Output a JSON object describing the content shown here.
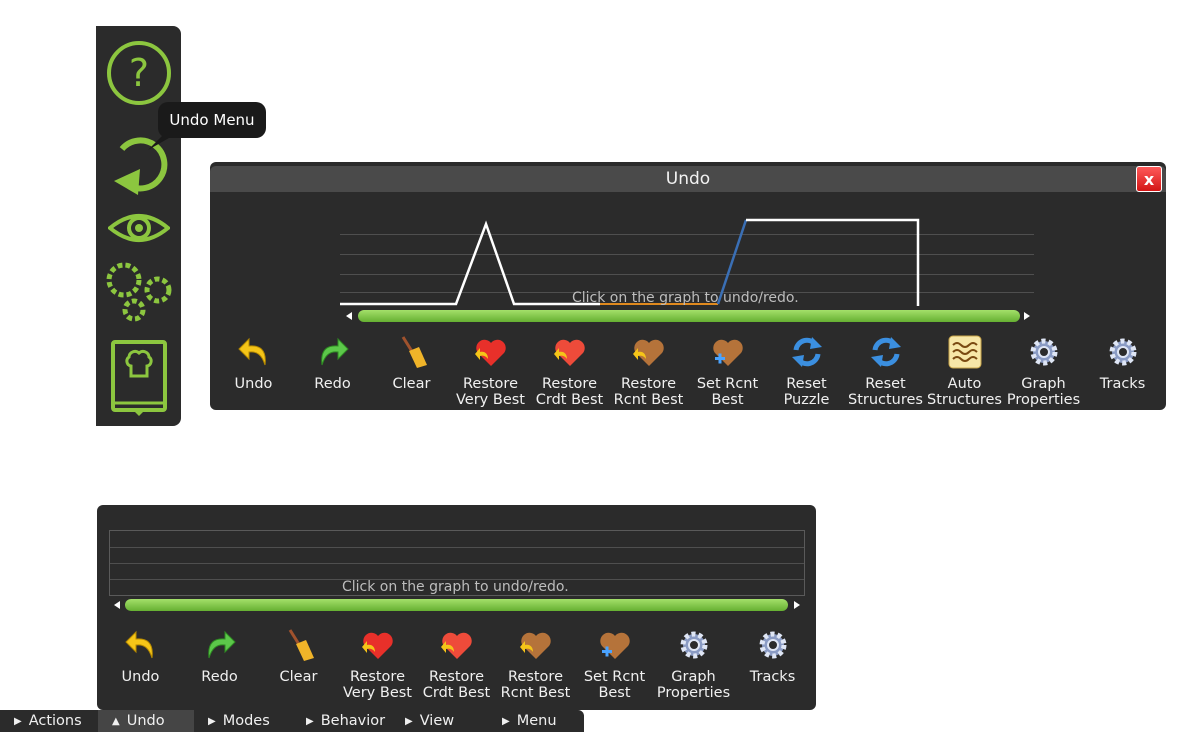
{
  "sidebar": {
    "tooltip": "Undo Menu",
    "buttons": [
      {
        "name": "help-icon",
        "glyph": "?"
      },
      {
        "name": "undo-menu-icon"
      },
      {
        "name": "view-eye-icon"
      },
      {
        "name": "settings-gears-icon"
      },
      {
        "name": "cookbook-icon"
      }
    ]
  },
  "undo_panel": {
    "title": "Undo",
    "close_label": "x",
    "hint": "Click on the graph to undo/redo.",
    "tools": [
      {
        "label": "Undo",
        "icon": "undo-icon"
      },
      {
        "label": "Redo",
        "icon": "redo-icon"
      },
      {
        "label": "Clear",
        "icon": "broom-icon"
      },
      {
        "label": "Restore\nVery Best",
        "icon": "heart-restore-icon"
      },
      {
        "label": "Restore\nCrdt Best",
        "icon": "heart-restore-icon"
      },
      {
        "label": "Restore\nRcnt Best",
        "icon": "heart-brown-restore-icon"
      },
      {
        "label": "Set Rcnt\nBest",
        "icon": "heart-plus-icon"
      },
      {
        "label": "Reset\nPuzzle",
        "icon": "refresh-icon"
      },
      {
        "label": "Reset\nStructures",
        "icon": "refresh-icon"
      },
      {
        "label": "Auto\nStructures",
        "icon": "auto-structures-icon"
      },
      {
        "label": "Graph\nProperties",
        "icon": "gear-icon"
      },
      {
        "label": "Tracks",
        "icon": "gear-icon"
      }
    ]
  },
  "small_panel": {
    "hint": "Click on the graph to undo/redo.",
    "tools": [
      {
        "label": "Undo",
        "icon": "undo-icon"
      },
      {
        "label": "Redo",
        "icon": "redo-icon"
      },
      {
        "label": "Clear",
        "icon": "broom-icon"
      },
      {
        "label": "Restore\nVery Best",
        "icon": "heart-restore-icon"
      },
      {
        "label": "Restore\nCrdt Best",
        "icon": "heart-restore-icon"
      },
      {
        "label": "Restore\nRcnt Best",
        "icon": "heart-brown-restore-icon"
      },
      {
        "label": "Set Rcnt\nBest",
        "icon": "heart-plus-icon"
      },
      {
        "label": "Graph\nProperties",
        "icon": "gear-icon"
      },
      {
        "label": "Tracks",
        "icon": "gear-icon"
      }
    ]
  },
  "menubar": {
    "items": [
      {
        "label": "Actions",
        "expanded": false
      },
      {
        "label": "Undo",
        "expanded": true
      },
      {
        "label": "Modes",
        "expanded": false
      },
      {
        "label": "Behavior",
        "expanded": false
      },
      {
        "label": "View",
        "expanded": false
      },
      {
        "label": "Menu",
        "expanded": false
      }
    ]
  },
  "colors": {
    "accent_green": "#8cc63f",
    "panel_bg": "#2b2b2b",
    "close_red": "#e02020",
    "graph_line": "#ffffff",
    "graph_blue": "#3a6fb5",
    "graph_orange": "#e08a1e"
  }
}
